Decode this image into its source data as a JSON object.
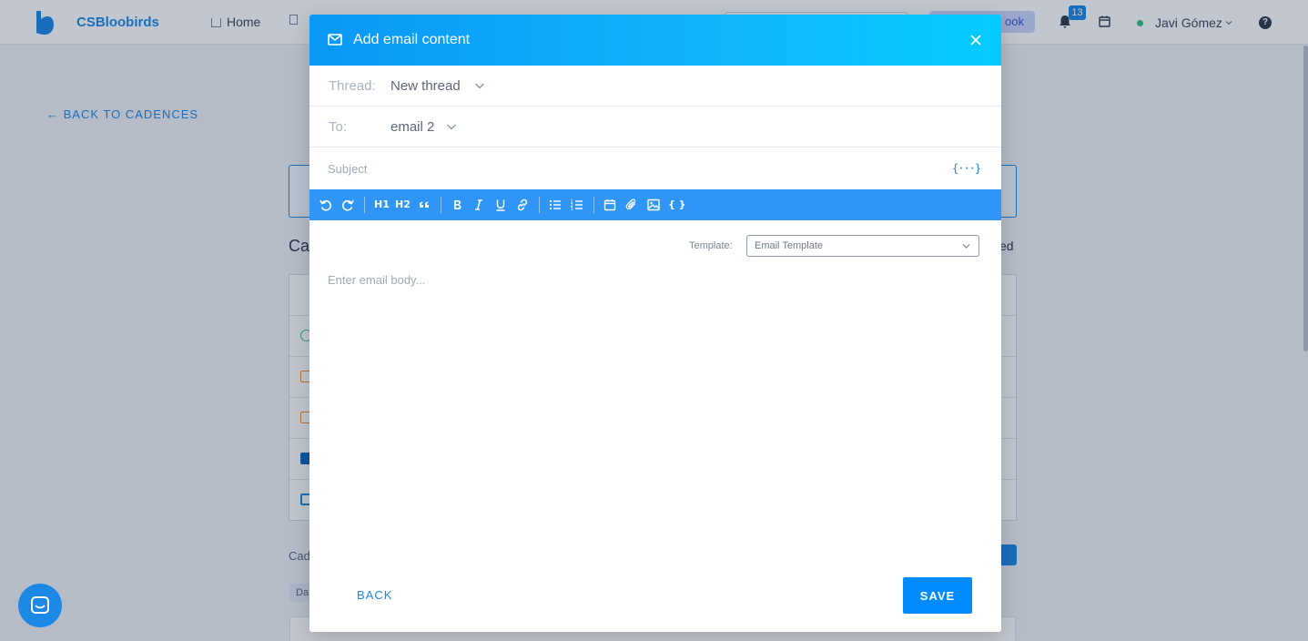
{
  "app": {
    "brand": "CSBloobirds",
    "nav_home": "Home",
    "book_label": "ook",
    "notifications_count": "13",
    "user_name": "Javi Gómez",
    "help": "?",
    "back_to_cadences": "← BACK TO CADENCES",
    "page_title_fragment": "Ca",
    "right_fragment": "ed",
    "cadence_fragment": "Cad",
    "day_pill": "Da",
    "row_icons": [
      "phone-icon",
      "email-icon",
      "email-icon",
      "linkedin-icon",
      "calendar-icon"
    ]
  },
  "modal": {
    "title": "Add email content",
    "icons": {
      "header": "mail-icon",
      "close": "close-icon"
    },
    "thread": {
      "label": "Thread:",
      "value": "New thread"
    },
    "to": {
      "label": "To:",
      "value": "email 2"
    },
    "subject": {
      "placeholder": "Subject",
      "variables_label": "{···}"
    },
    "toolbar": {
      "h1": "H1",
      "h2": "H2",
      "variables": "{ }",
      "icons": [
        "undo-icon",
        "redo-icon",
        "heading1-icon",
        "heading2-icon",
        "quote-icon",
        "bold-icon",
        "italic-icon",
        "underline-icon",
        "link-icon",
        "bulleted-list-icon",
        "numbered-list-icon",
        "calendar-icon",
        "attachment-icon",
        "image-icon",
        "variables-icon"
      ]
    },
    "template": {
      "label": "Template:",
      "selected": "Email Template"
    },
    "body": {
      "placeholder": "Enter email body..."
    },
    "back_label": "BACK",
    "save_label": "SAVE"
  },
  "colors": {
    "accent": "#1b88e6",
    "header_gradient_start": "#0a97f5",
    "header_gradient_end": "#03cbfd",
    "toolbar": "#2f96f5",
    "save_button": "#008cff"
  }
}
